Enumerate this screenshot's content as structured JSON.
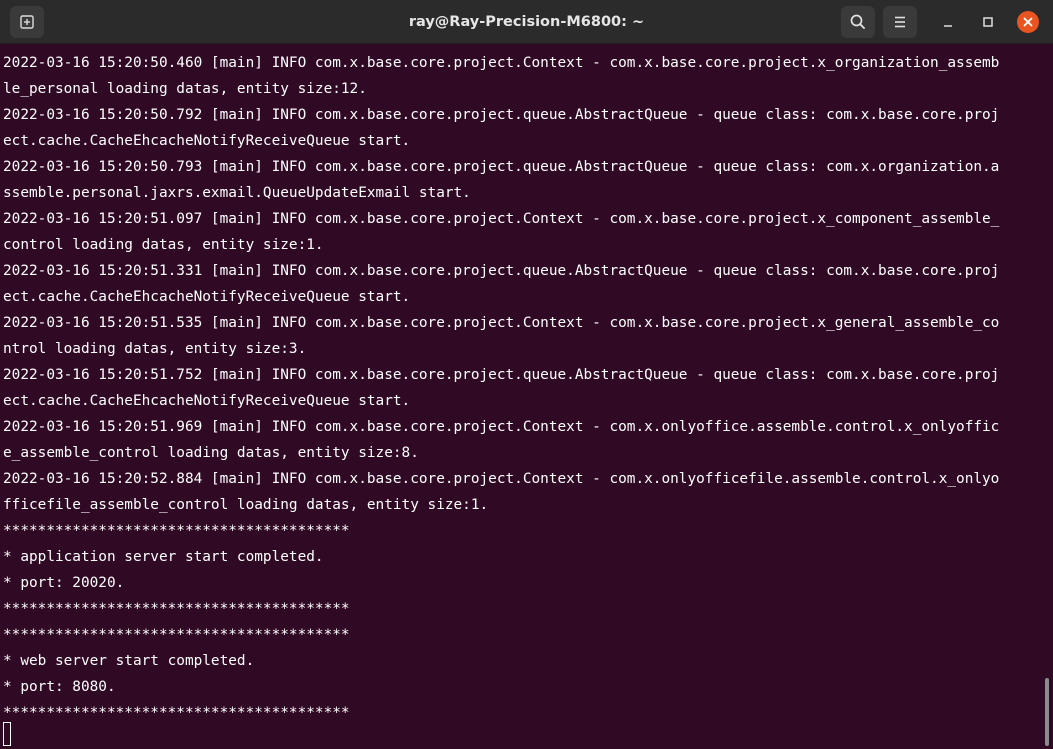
{
  "window": {
    "title": "ray@Ray-Precision-M6800: ~"
  },
  "toolbar": {
    "new_tab_icon": "new-tab-icon",
    "search_icon": "search-icon",
    "menu_icon": "hamburger-menu-icon",
    "minimize_icon": "minimize-icon",
    "maximize_icon": "maximize-icon",
    "close_icon": "close-icon"
  },
  "colors": {
    "terminal_background": "#300a24",
    "titlebar_background": "#2b2b2b",
    "text": "#ffffff",
    "close_button": "#e95420"
  },
  "terminal": {
    "lines": [
      "2022-03-16 15:20:50.460 [main] INFO com.x.base.core.project.Context - com.x.base.core.project.x_organization_assemb",
      "le_personal loading datas, entity size:12.",
      "2022-03-16 15:20:50.792 [main] INFO com.x.base.core.project.queue.AbstractQueue - queue class: com.x.base.core.proj",
      "ect.cache.CacheEhcacheNotifyReceiveQueue start.",
      "2022-03-16 15:20:50.793 [main] INFO com.x.base.core.project.queue.AbstractQueue - queue class: com.x.organization.a",
      "ssemble.personal.jaxrs.exmail.QueueUpdateExmail start.",
      "2022-03-16 15:20:51.097 [main] INFO com.x.base.core.project.Context - com.x.base.core.project.x_component_assemble_",
      "control loading datas, entity size:1.",
      "2022-03-16 15:20:51.331 [main] INFO com.x.base.core.project.queue.AbstractQueue - queue class: com.x.base.core.proj",
      "ect.cache.CacheEhcacheNotifyReceiveQueue start.",
      "2022-03-16 15:20:51.535 [main] INFO com.x.base.core.project.Context - com.x.base.core.project.x_general_assemble_co",
      "ntrol loading datas, entity size:3.",
      "2022-03-16 15:20:51.752 [main] INFO com.x.base.core.project.queue.AbstractQueue - queue class: com.x.base.core.proj",
      "ect.cache.CacheEhcacheNotifyReceiveQueue start.",
      "2022-03-16 15:20:51.969 [main] INFO com.x.base.core.project.Context - com.x.onlyoffice.assemble.control.x_onlyoffic",
      "e_assemble_control loading datas, entity size:8.",
      "2022-03-16 15:20:52.884 [main] INFO com.x.base.core.project.Context - com.x.onlyofficefile.assemble.control.x_onlyo",
      "fficefile_assemble_control loading datas, entity size:1.",
      "****************************************",
      "* application server start completed.",
      "* port: 20020.",
      "****************************************",
      "****************************************",
      "* web server start completed.",
      "* port: 8080.",
      "****************************************"
    ]
  }
}
